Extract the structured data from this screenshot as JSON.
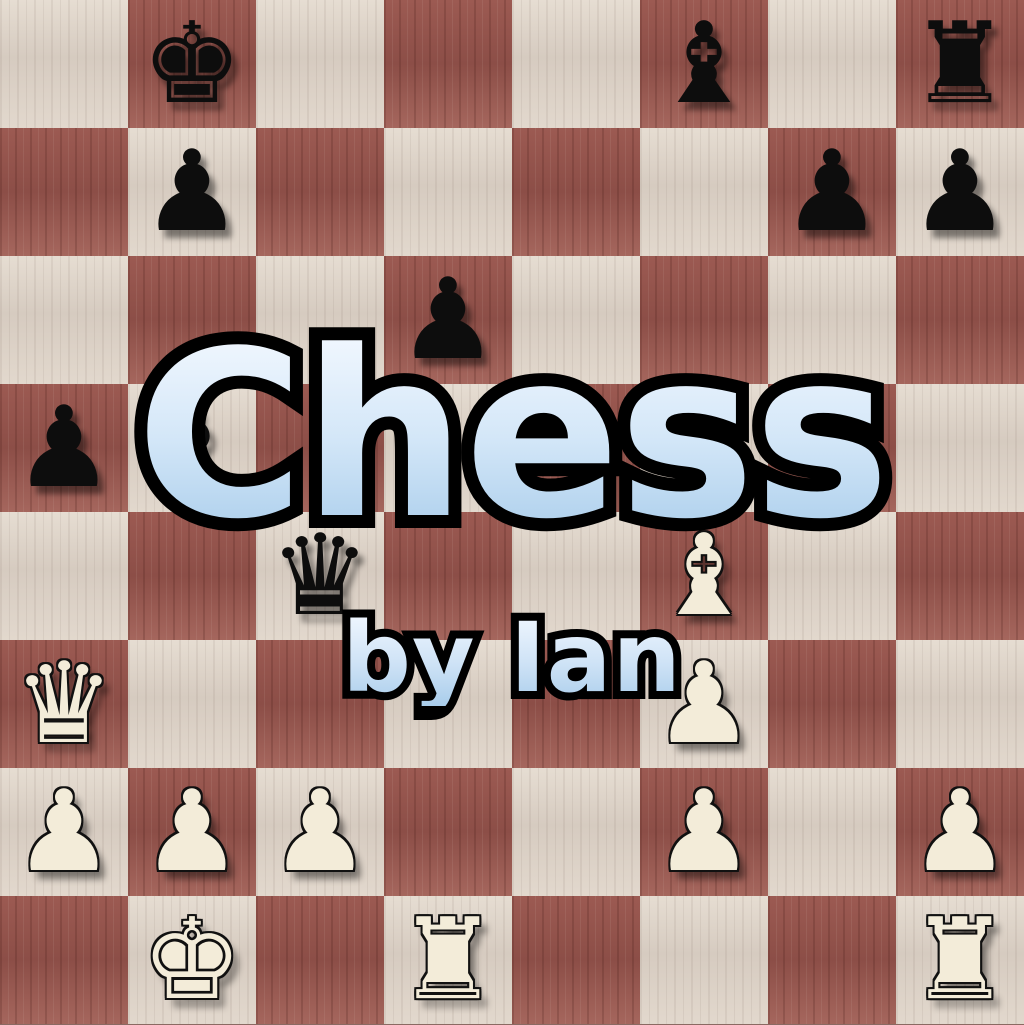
{
  "title": "Chess",
  "subtitle": "by Ian",
  "board": {
    "light_color": "#e0d6cb",
    "dark_color": "#955750",
    "accent_color": "#bcdcf4"
  },
  "pieces": [
    {
      "name": "black-king-icon",
      "color": "black",
      "symbol": "♚",
      "square": "b8"
    },
    {
      "name": "black-bishop-icon",
      "color": "black",
      "symbol": "♝",
      "square": "f8"
    },
    {
      "name": "black-rook-icon",
      "color": "black",
      "symbol": "♜",
      "square": "h8"
    },
    {
      "name": "black-pawn-icon",
      "color": "black",
      "symbol": "♟",
      "square": "b7"
    },
    {
      "name": "black-pawn-icon",
      "color": "black",
      "symbol": "♟",
      "square": "g7"
    },
    {
      "name": "black-pawn-icon",
      "color": "black",
      "symbol": "♟",
      "square": "h7"
    },
    {
      "name": "black-pawn-icon",
      "color": "black",
      "symbol": "♟",
      "square": "d6"
    },
    {
      "name": "black-pawn-icon",
      "color": "black",
      "symbol": "♟",
      "square": "a5"
    },
    {
      "name": "black-bishop-icon",
      "color": "black",
      "symbol": "♝",
      "square": "b5"
    },
    {
      "name": "black-queen-icon",
      "color": "black",
      "symbol": "♛",
      "square": "c4"
    },
    {
      "name": "white-bishop-icon",
      "color": "white",
      "symbol": "♝",
      "square": "f4"
    },
    {
      "name": "white-queen-icon",
      "color": "white",
      "symbol": "♛",
      "square": "a3"
    },
    {
      "name": "white-pawn-icon",
      "color": "white",
      "symbol": "♟",
      "square": "f3"
    },
    {
      "name": "white-pawn-icon",
      "color": "white",
      "symbol": "♟",
      "square": "a2"
    },
    {
      "name": "white-pawn-icon",
      "color": "white",
      "symbol": "♟",
      "square": "b2"
    },
    {
      "name": "white-pawn-icon",
      "color": "white",
      "symbol": "♟",
      "square": "c2"
    },
    {
      "name": "white-pawn-icon",
      "color": "white",
      "symbol": "♟",
      "square": "f2"
    },
    {
      "name": "white-pawn-icon",
      "color": "white",
      "symbol": "♟",
      "square": "h2"
    },
    {
      "name": "white-king-icon",
      "color": "white",
      "symbol": "♚",
      "square": "b1"
    },
    {
      "name": "white-rook-icon",
      "color": "white",
      "symbol": "♜",
      "square": "d1"
    },
    {
      "name": "white-rook-icon",
      "color": "white",
      "symbol": "♜",
      "square": "h1"
    }
  ]
}
